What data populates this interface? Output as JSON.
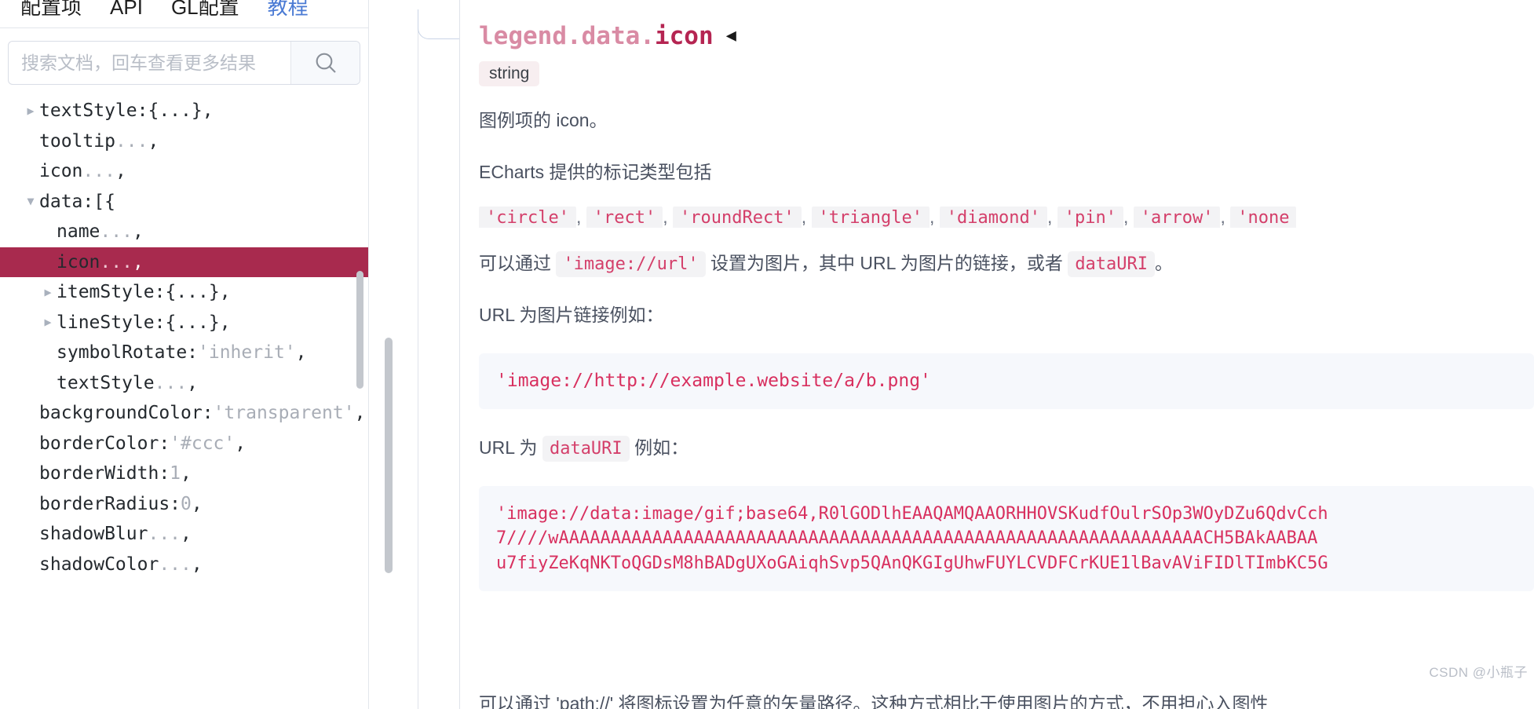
{
  "left": {
    "tabs": [
      {
        "label": "配置项",
        "active": false
      },
      {
        "label": "API",
        "active": false
      },
      {
        "label": "GL配置",
        "active": false
      },
      {
        "label": "教程",
        "active": true
      }
    ],
    "search": {
      "placeholder": "搜索文档，回车查看更多结果",
      "value": "",
      "icon": "search-icon"
    },
    "tree": [
      {
        "caret": "right",
        "indent": 0,
        "key": "textStyle:",
        "value": "{...}",
        "tail": ",",
        "selected": false,
        "valueMuted": false
      },
      {
        "caret": "none",
        "indent": 0,
        "key": "tooltip",
        "value": "...",
        "tail": ",",
        "selected": false,
        "valueMuted": true
      },
      {
        "caret": "none",
        "indent": 0,
        "key": "icon",
        "value": "...",
        "tail": ",",
        "selected": false,
        "valueMuted": true
      },
      {
        "caret": "down",
        "indent": 0,
        "key": "data:",
        "value": "[{",
        "tail": "",
        "selected": false,
        "valueMuted": false
      },
      {
        "caret": "none",
        "indent": 1,
        "key": "name",
        "value": "...",
        "tail": ",",
        "selected": false,
        "valueMuted": true
      },
      {
        "caret": "none",
        "indent": 1,
        "key": "icon",
        "value": "...",
        "tail": ",",
        "selected": true,
        "valueMuted": true
      },
      {
        "caret": "right",
        "indent": 1,
        "key": "itemStyle:",
        "value": "{...}",
        "tail": ",",
        "selected": false,
        "valueMuted": false
      },
      {
        "caret": "right",
        "indent": 1,
        "key": "lineStyle:",
        "value": "{...}",
        "tail": ",",
        "selected": false,
        "valueMuted": false
      },
      {
        "caret": "none",
        "indent": 1,
        "key": "symbolRotate:",
        "value": "'inherit'",
        "tail": ",",
        "selected": false,
        "valueMuted": true
      },
      {
        "caret": "none",
        "indent": 1,
        "key": "textStyle",
        "value": "...",
        "tail": ",",
        "selected": false,
        "valueMuted": true
      },
      {
        "caret": "none",
        "indent": 0,
        "key": "backgroundColor:",
        "value": "'transparent'",
        "tail": ",",
        "selected": false,
        "valueMuted": true
      },
      {
        "caret": "none",
        "indent": 0,
        "key": "borderColor:",
        "value": "'#ccc'",
        "tail": ",",
        "selected": false,
        "valueMuted": true
      },
      {
        "caret": "none",
        "indent": 0,
        "key": "borderWidth:",
        "value": "1",
        "tail": ",",
        "selected": false,
        "valueMuted": true
      },
      {
        "caret": "none",
        "indent": 0,
        "key": "borderRadius:",
        "value": "0",
        "tail": ",",
        "selected": false,
        "valueMuted": true
      },
      {
        "caret": "none",
        "indent": 0,
        "key": "shadowBlur",
        "value": "...",
        "tail": ",",
        "selected": false,
        "valueMuted": true
      },
      {
        "caret": "none",
        "indent": 0,
        "key": "shadowColor",
        "value": "...",
        "tail": ",",
        "selected": false,
        "valueMuted": true
      }
    ]
  },
  "doc": {
    "title_prefix": "legend.data.",
    "title_main": "icon",
    "collapse_icon": "◀",
    "type_badge": "string",
    "p1": "图例项的 icon。",
    "p2": "ECharts 提供的标记类型包括",
    "marker_tokens": [
      "'circle'",
      "'rect'",
      "'roundRect'",
      "'triangle'",
      "'diamond'",
      "'pin'",
      "'arrow'",
      "'none"
    ],
    "token_separator": ",",
    "p3_before": "可以通过",
    "p3_code1": "'image://url'",
    "p3_middle": "设置为图片，其中 URL 为图片的链接，或者",
    "p3_code2": "dataURI",
    "p3_after": "。",
    "p4": "URL 为图片链接例如：",
    "code1_lines": [
      "'image://http://example.website/a/b.png'"
    ],
    "p5_before": "URL 为",
    "p5_code": "dataURI",
    "p5_after": "例如：",
    "code2_lines": [
      "'image://data:image/gif;base64,R0lGODlhEAAQAMQAAORHHOVSKudfOulrSOp3WOyDZu6QdvCch",
      "7////wAAAAAAAAAAAAAAAAAAAAAAAAAAAAAAAAAAAAAAAAAAAAAAAAAAAAAAAAAAAAAACH5BAkAABAA",
      "u7fiyZeKqNKToQGDsM8hBADgUXoGAiqhSvp5QAnQKGIgUhwFUYLCVDFCrKUE1lBavAViFIDlTImbKC5G"
    ],
    "bottom_cut_text": "可以通过 'path://' 将图标设置为任意的矢量路径。这种方式相比于使用图片的方式，不用担心入图性",
    "watermark": "CSDN @小瓶子"
  }
}
